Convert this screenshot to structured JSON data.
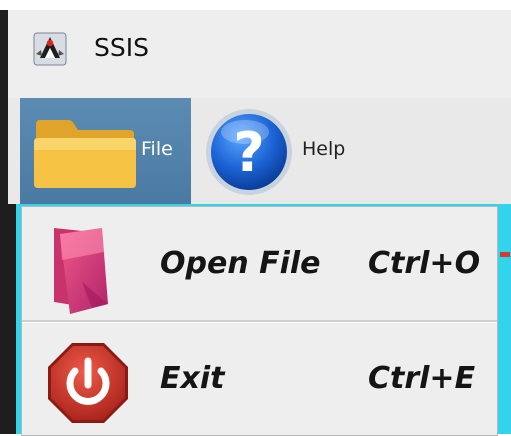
{
  "window": {
    "title": "SSIS",
    "icon": "java-duke-icon"
  },
  "menu_bar": {
    "items": [
      {
        "label": "File",
        "icon": "folder-icon",
        "active": true
      },
      {
        "label": "Help",
        "icon": "help-icon",
        "active": false
      }
    ]
  },
  "file_menu": {
    "items": [
      {
        "label": "Open File",
        "accelerator": "Ctrl+O",
        "icon": "open-folder-icon"
      },
      {
        "label": "Exit",
        "accelerator": "Ctrl+E",
        "icon": "power-icon"
      }
    ]
  },
  "colors": {
    "menu_active_bg": "#4f7fa8",
    "content_bg": "#31d4ea",
    "exit_icon_red": "#d0372b",
    "open_icon_pink": "#e0457e"
  }
}
